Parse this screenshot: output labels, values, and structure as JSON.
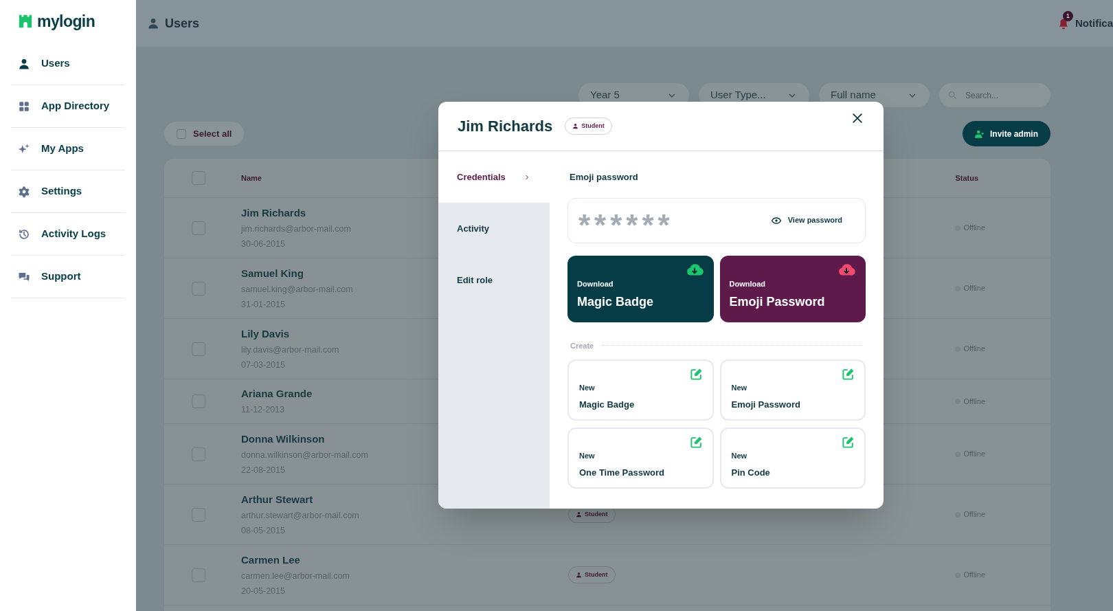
{
  "sidebar": {
    "logo": "mylogin",
    "items": [
      {
        "label": "Users"
      },
      {
        "label": "App Directory"
      },
      {
        "label": "My Apps"
      },
      {
        "label": "Settings"
      },
      {
        "label": "Activity Logs"
      },
      {
        "label": "Support"
      }
    ]
  },
  "header": {
    "title": "Users",
    "notification_count": "1",
    "notifications_label": "Notifica"
  },
  "filters": [
    {
      "value": "Year 5"
    },
    {
      "value": "User Type..."
    },
    {
      "value": "Full name"
    }
  ],
  "search": {
    "placeholder": "Search..."
  },
  "select_all": {
    "label": "Select all",
    "checked": false
  },
  "invite_button": {
    "label": "Invite admin"
  },
  "table": {
    "header_checked": false,
    "columns": [
      {
        "label": "Name"
      },
      {
        "label": "Status"
      }
    ],
    "rows": [
      {
        "checked": false,
        "name": "Jim Richards",
        "email": "jim.richards@arbor-mail.com",
        "date": "30-06-2015",
        "status": "Offline"
      },
      {
        "checked": false,
        "name": "Samuel King",
        "email": "samuel.king@arbor-mail.com",
        "date": "31-01-2015",
        "status": "Offline"
      },
      {
        "checked": false,
        "name": "Lily Davis",
        "email": "lily.davis@arbor-mail.com",
        "date": "07-03-2015",
        "status": "Offline"
      },
      {
        "checked": false,
        "name": "Ariana Grande",
        "date": "11-12-2013",
        "status": "Offline"
      },
      {
        "checked": false,
        "name": "Donna Wilkinson",
        "email": "donna.wilkinson@arbor-mail.com",
        "date": "22-08-2015",
        "status": "Offline"
      },
      {
        "checked": false,
        "name": "Arthur Stewart",
        "email": "arthur.stewart@arbor-mail.com",
        "date": "08-05-2015",
        "role": "Student",
        "status": "Offline"
      },
      {
        "checked": false,
        "name": "Carmen Lee",
        "email": "carmen.lee@arbor-mail.com",
        "date": "20-05-2015",
        "role": "Student",
        "status": "Offline"
      }
    ]
  },
  "modal": {
    "title": "Jim Richards",
    "role": "Student",
    "nav": [
      {
        "label": "Credentials",
        "selected": true
      },
      {
        "label": "Activity",
        "selected": false
      },
      {
        "label": "Edit role",
        "selected": false
      }
    ],
    "section_title": "Emoji password",
    "password_mask": "******",
    "view_password": "View password",
    "downloads": [
      {
        "kicker": "Download",
        "label": "Magic Badge",
        "color": "#053c46"
      },
      {
        "kicker": "Download",
        "label": "Emoji Password",
        "color": "#5e1a4a"
      }
    ],
    "create_label": "Create",
    "create_items": [
      {
        "kicker": "New",
        "label": "Magic Badge"
      },
      {
        "kicker": "New",
        "label": "Emoji Password"
      },
      {
        "kicker": "New",
        "label": "One Time Password"
      },
      {
        "kicker": "New",
        "label": "Pin Code"
      }
    ]
  }
}
